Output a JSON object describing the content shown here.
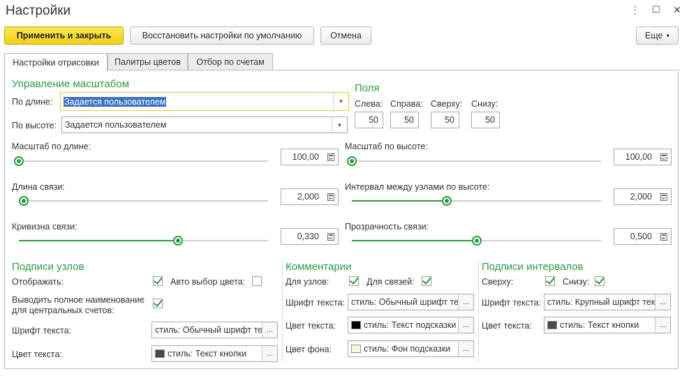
{
  "window": {
    "title": "Настройки",
    "menu_glyph": "⋮",
    "maximize_glyph": "☐",
    "close_glyph": "✕"
  },
  "toolbar": {
    "apply_close": "Применить и закрыть",
    "restore_defaults": "Восстановить настройки по умолчанию",
    "cancel": "Отмена",
    "more": "Еще",
    "more_arrow": "▾"
  },
  "tabs": [
    "Настройки отрисовки",
    "Палитры цветов",
    "Отбор по счетам"
  ],
  "scale_control": {
    "heading": "Управление масштабом",
    "by_length_label": "По длине:",
    "by_length_value": "Задается пользователем",
    "by_height_label": "По высоте:",
    "by_height_value": "Задается пользователем"
  },
  "margins": {
    "heading": "Поля",
    "left_label": "Слева:",
    "left_value": "50",
    "right_label": "Справа:",
    "right_value": "50",
    "top_label": "Сверху:",
    "top_value": "50",
    "bottom_label": "Снизу:",
    "bottom_value": "50"
  },
  "sliders": {
    "scale_length": {
      "label": "Масштаб по длине:",
      "value": "100,00",
      "level": 0.0
    },
    "scale_height": {
      "label": "Масштаб по высоте:",
      "value": "100,00",
      "level": 0.0
    },
    "link_length": {
      "label": "Длина связи:",
      "value": "2,000",
      "level": 0.02
    },
    "node_interval": {
      "label": "Интервал между узлами по высоте:",
      "value": "2,000",
      "level": 0.38
    },
    "link_curvature": {
      "label": "Кривизна связи:",
      "value": "0,330",
      "level": 0.64
    },
    "link_transparency": {
      "label": "Прозрачность связи:",
      "value": "0,500",
      "level": 0.5
    }
  },
  "node_labels": {
    "heading": "Подписи узлов",
    "show_label": "Отображать:",
    "show_checked": true,
    "auto_color_label": "Авто выбор цвета:",
    "auto_color_checked": false,
    "full_name_label_1": "Выводить полное наименование",
    "full_name_label_2": "для центральных счетов:",
    "full_name_checked": true,
    "font_label": "Шрифт текста:",
    "font_value": "стиль: Обычный шрифт текста",
    "color_label": "Цвет текста:",
    "color_value": "стиль: Текст кнопки",
    "color_swatch": "#4a4a4a"
  },
  "comments": {
    "heading": "Комментарии",
    "for_nodes_label": "Для узлов:",
    "for_nodes_checked": true,
    "for_links_label": "Для связей:",
    "for_links_checked": true,
    "font_label": "Шрифт текста:",
    "font_value": "стиль: Обычный шрифт текста",
    "color_label": "Цвет текста:",
    "color_value": "стиль: Текст подсказки",
    "color_swatch": "#000000",
    "bg_label": "Цвет фона:",
    "bg_value": "стиль: Фон подсказки",
    "bg_swatch": "#fdf6d8"
  },
  "interval_labels": {
    "heading": "Подписи интервалов",
    "top_label": "Сверху:",
    "top_checked": true,
    "bottom_label": "Снизу:",
    "bottom_checked": true,
    "font_label": "Шрифт текста:",
    "font_value": "стиль: Крупный шрифт текста",
    "color_label": "Цвет текста:",
    "color_value": "стиль: Текст кнопки",
    "color_swatch": "#4a4a4a"
  },
  "ellipsis": "..."
}
